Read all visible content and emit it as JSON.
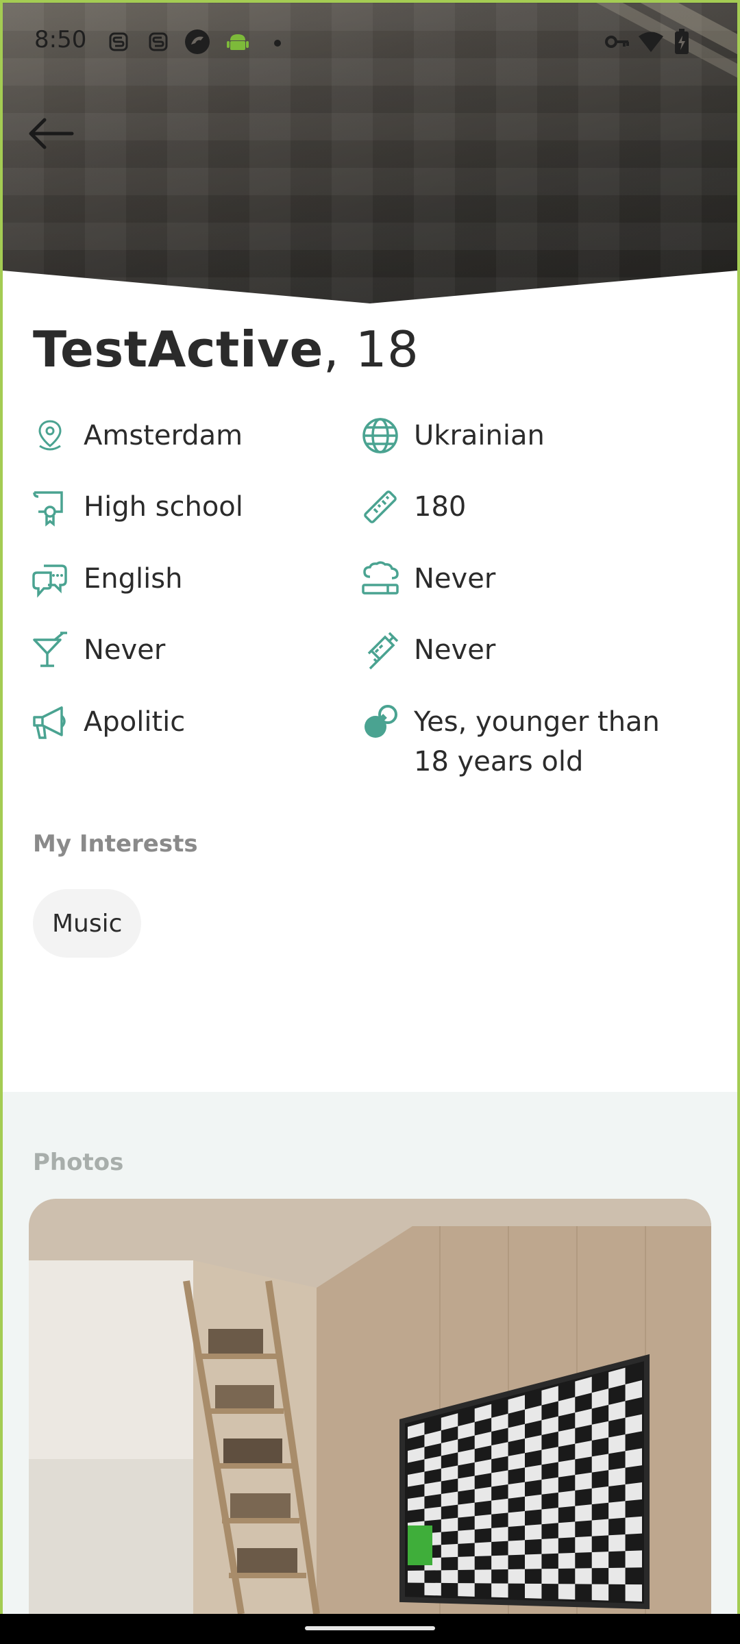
{
  "status_bar": {
    "time": "8:50"
  },
  "profile": {
    "name": "TestActive",
    "age_text": ", 18"
  },
  "info": {
    "city": "Amsterdam",
    "nationality": "Ukrainian",
    "education": "High school",
    "height": "180",
    "language": "English",
    "smoking": "Never",
    "drinking": "Never",
    "drugs": "Never",
    "politics": "Apolitic",
    "children": "Yes, younger than 18 years old"
  },
  "interests": {
    "label": "My Interests",
    "items": [
      "Music"
    ]
  },
  "photos": {
    "label": "Photos"
  },
  "colors": {
    "accent": "#4aa391",
    "frame": "#a4cc53"
  }
}
